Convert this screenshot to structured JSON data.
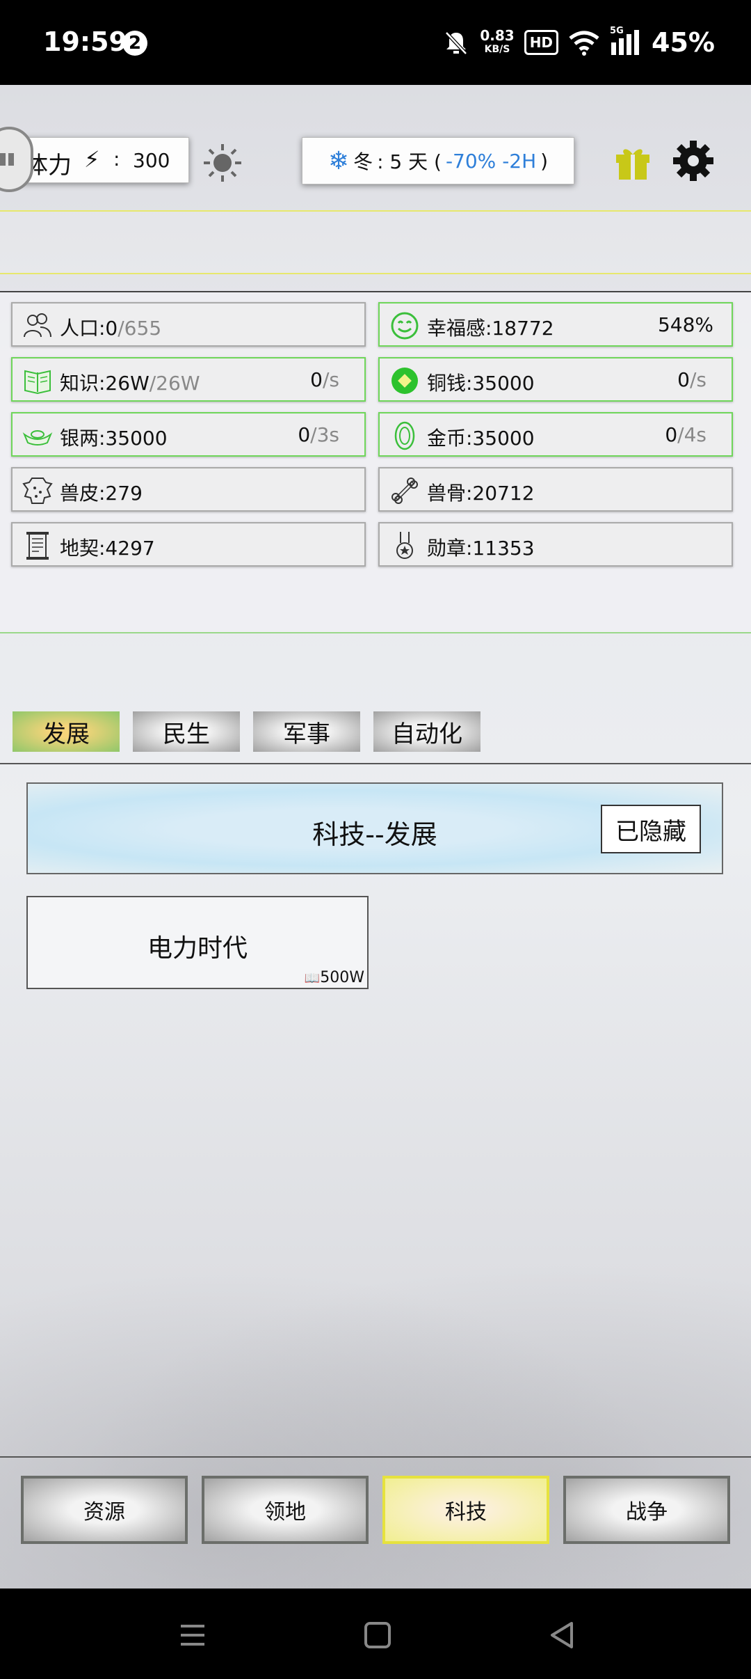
{
  "status_bar": {
    "time": "19:59",
    "badge": "2",
    "net_speed": "0.83",
    "net_unit": "KB/S",
    "hd": "HD",
    "signal_label": "5G",
    "battery": "45%"
  },
  "header": {
    "stamina_label": "体力",
    "stamina_bolt": "⚡",
    "stamina_colon": ":",
    "stamina_value": "300",
    "season_name": "冬",
    "season_days": ": 5 天 (",
    "season_effect": "-70% -2H",
    "season_close": ")"
  },
  "resources": [
    {
      "name": "人口:0",
      "secondary": "/655",
      "rate": "",
      "rate_unit": ""
    },
    {
      "name": "幸福感:18772",
      "secondary": "",
      "rate": "548%",
      "rate_unit": ""
    },
    {
      "name": "知识:26W",
      "secondary": "/26W",
      "rate": "0",
      "rate_unit": "/s"
    },
    {
      "name": "铜钱:35000",
      "secondary": "",
      "rate": "0",
      "rate_unit": "/s"
    },
    {
      "name": "银两:35000",
      "secondary": "",
      "rate": "0",
      "rate_unit": "/3s"
    },
    {
      "name": "金币:35000",
      "secondary": "",
      "rate": "0",
      "rate_unit": "/4s"
    },
    {
      "name": "兽皮:279",
      "secondary": "",
      "rate": "",
      "rate_unit": ""
    },
    {
      "name": "兽骨:20712",
      "secondary": "",
      "rate": "",
      "rate_unit": ""
    },
    {
      "name": "地契:4297",
      "secondary": "",
      "rate": "",
      "rate_unit": ""
    },
    {
      "name": "勋章:11353",
      "secondary": "",
      "rate": "",
      "rate_unit": ""
    }
  ],
  "tabs": [
    "发展",
    "民生",
    "军事",
    "自动化"
  ],
  "section": {
    "title": "科技--发展",
    "hidden_button": "已隐藏"
  },
  "tech_item": {
    "name": "电力时代",
    "cost_icon": "📖",
    "cost": "500W"
  },
  "bottom_nav": [
    "资源",
    "领地",
    "科技",
    "战争"
  ],
  "colors": {
    "active_tab": "#90c76a",
    "active_nav": "#e6e23e",
    "season_blue": "#2e7fd9",
    "resource_green_border": "#6fd65a",
    "gift": "#c8c818"
  }
}
